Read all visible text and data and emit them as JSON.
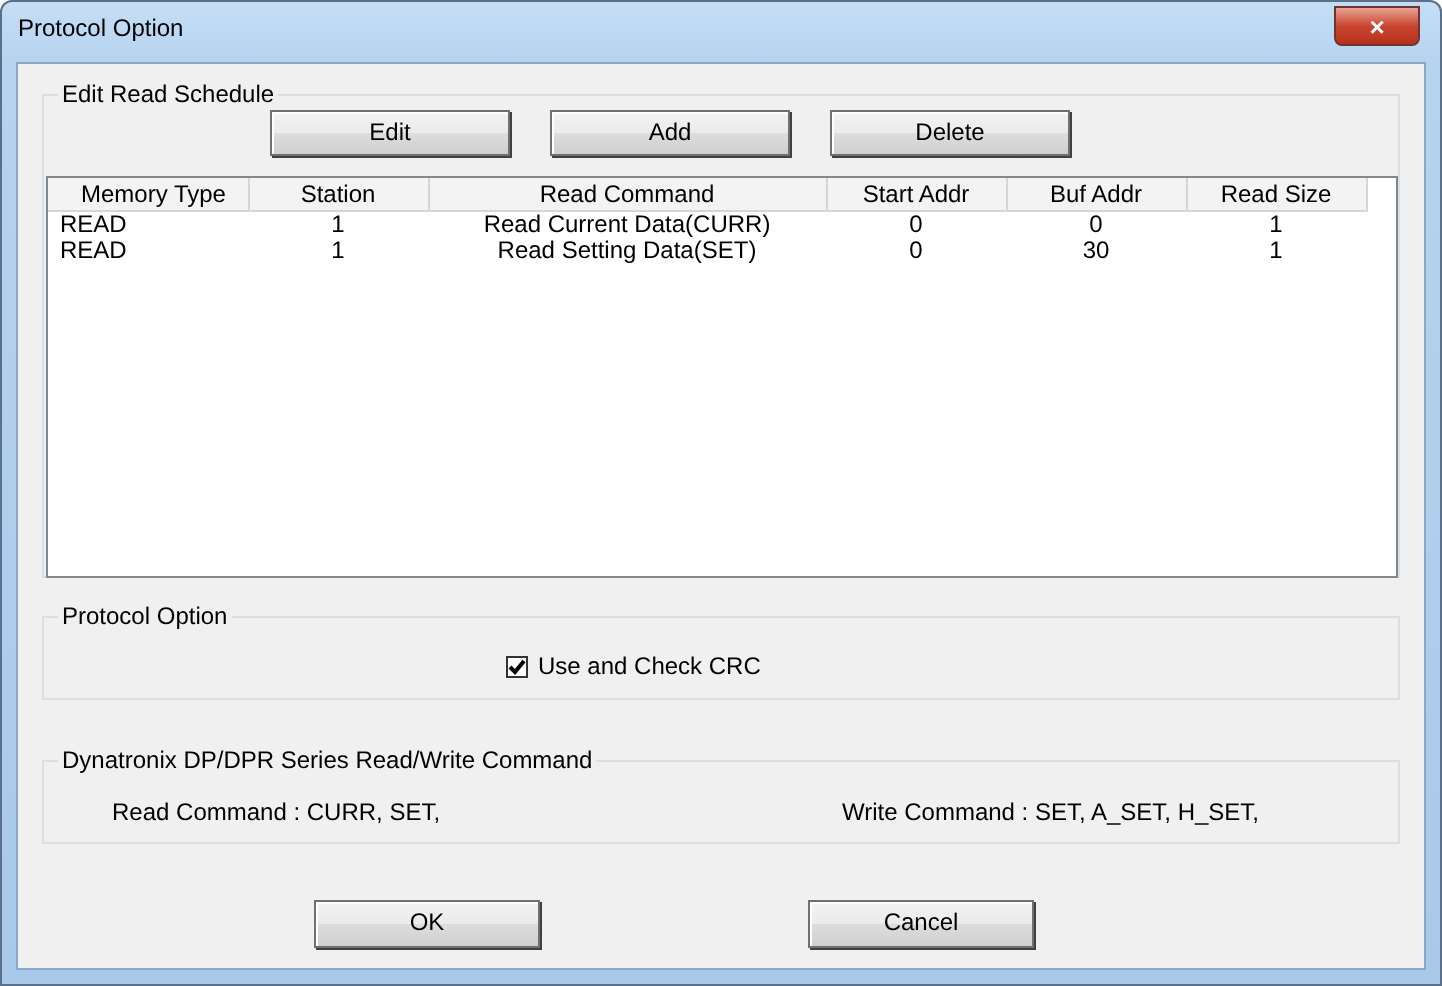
{
  "window": {
    "title": "Protocol Option",
    "close": "×"
  },
  "schedule": {
    "legend": "Edit Read Schedule",
    "buttons": [
      "Edit",
      "Add",
      "Delete"
    ],
    "table": {
      "columns": [
        "Memory Type",
        "Station",
        "Read Command",
        "Start Addr",
        "Buf Addr",
        "Read Size"
      ],
      "rows": [
        [
          "READ",
          "1",
          "Read Current Data(CURR)",
          "0",
          "0",
          "1"
        ],
        [
          "READ",
          "1",
          "Read Setting Data(SET)",
          "0",
          "30",
          "1"
        ]
      ]
    }
  },
  "protocol": {
    "legend": "Protocol Option",
    "checkbox": {
      "label": "Use and Check CRC",
      "checked": true
    }
  },
  "commands": {
    "legend": "Dynatronix DP/DPR Series Read/Write Command",
    "read": "Read Command : CURR, SET,",
    "write": "Write Command : SET, A_SET, H_SET,"
  },
  "buttons": [
    "OK",
    "Cancel"
  ]
}
